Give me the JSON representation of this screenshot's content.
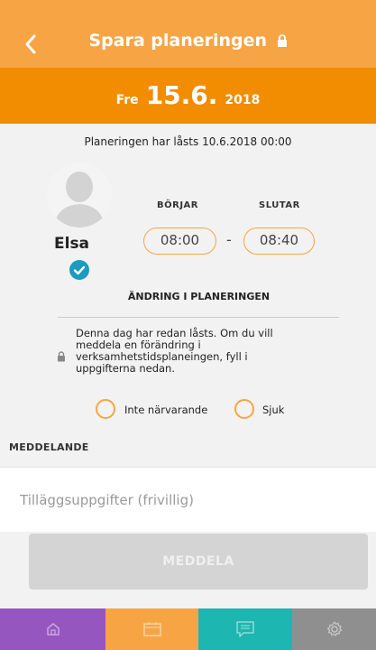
{
  "header": {
    "title": "Spara planeringen"
  },
  "date": {
    "weekday": "Fre",
    "day": "15.6.",
    "year": "2018"
  },
  "locked_info": "Planeringen har låsts 10.6.2018 00:00",
  "child": {
    "name": "Elsa"
  },
  "times": {
    "start_label": "BÖRJAR",
    "end_label": "SLUTAR",
    "start": "08:00",
    "end": "08:40",
    "separator": "-"
  },
  "change": {
    "title": "ÄNDRING I PLANERINGEN",
    "notice": "Denna dag har redan låsts. Om du vill meddela en förändring i verksamhetstidsplaneingen, fyll i uppgifterna nedan."
  },
  "options": {
    "absent": "Inte närvarande",
    "sick": "Sjuk"
  },
  "message": {
    "label": "MEDDELANDE",
    "placeholder": "Tilläggsuppgifter (frivillig)",
    "value": ""
  },
  "submit_label": "MEDDELA",
  "tabs": [
    {
      "icon": "home-icon",
      "color": "#9656c0"
    },
    {
      "icon": "calendar-icon",
      "color": "#f7a544"
    },
    {
      "icon": "message-icon",
      "color": "#1db6b0"
    },
    {
      "icon": "gear-icon",
      "color": "#8f8f8f"
    }
  ],
  "colors": {
    "header": "#f7a544",
    "date_bar": "#f28c00",
    "check": "#1a9bbf",
    "button_disabled": "#d4d4d4"
  }
}
